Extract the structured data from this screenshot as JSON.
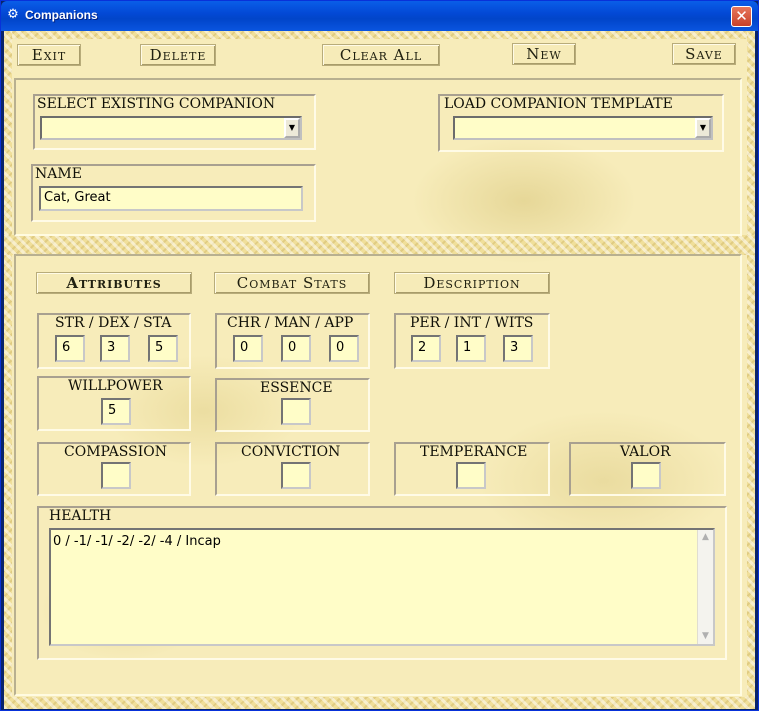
{
  "window": {
    "title": "Companions",
    "close_glyph": "✕",
    "icon": "gear-icon"
  },
  "toolbar": {
    "exit_label": "Exit",
    "delete_label": "Delete",
    "clear_all_label": "Clear All",
    "new_label": "New",
    "save_label": "Save"
  },
  "select": {
    "existing_label": "SELECT EXISTING COMPANION",
    "existing_value": "",
    "template_label": "LOAD COMPANION TEMPLATE",
    "template_value": "",
    "arrow": "▼"
  },
  "name": {
    "label": "NAME",
    "value": "Cat, Great"
  },
  "tabs": {
    "attributes": "Attributes",
    "combat": "Combat Stats",
    "description": "Description"
  },
  "physical": {
    "label": "STR / DEX / STA",
    "str": "6",
    "dex": "3",
    "sta": "5"
  },
  "social": {
    "label": "CHR / MAN / APP",
    "chr": "0",
    "man": "0",
    "app": "0"
  },
  "mental": {
    "label": "PER / INT / WITS",
    "per": "2",
    "int": "1",
    "wits": "3"
  },
  "willpower": {
    "label": "WILLPOWER",
    "value": "5"
  },
  "essence": {
    "label": "ESSENCE",
    "value": ""
  },
  "virtues": {
    "compassion": {
      "label": "COMPASSION",
      "value": ""
    },
    "conviction": {
      "label": "CONVICTION",
      "value": ""
    },
    "temperance": {
      "label": "TEMPERANCE",
      "value": ""
    },
    "valor": {
      "label": "VALOR",
      "value": ""
    }
  },
  "health": {
    "label": "HEALTH",
    "value": "0 / -1/ -1/ -2/ -2/ -4 / Incap",
    "up": "▲",
    "down": "▼"
  }
}
